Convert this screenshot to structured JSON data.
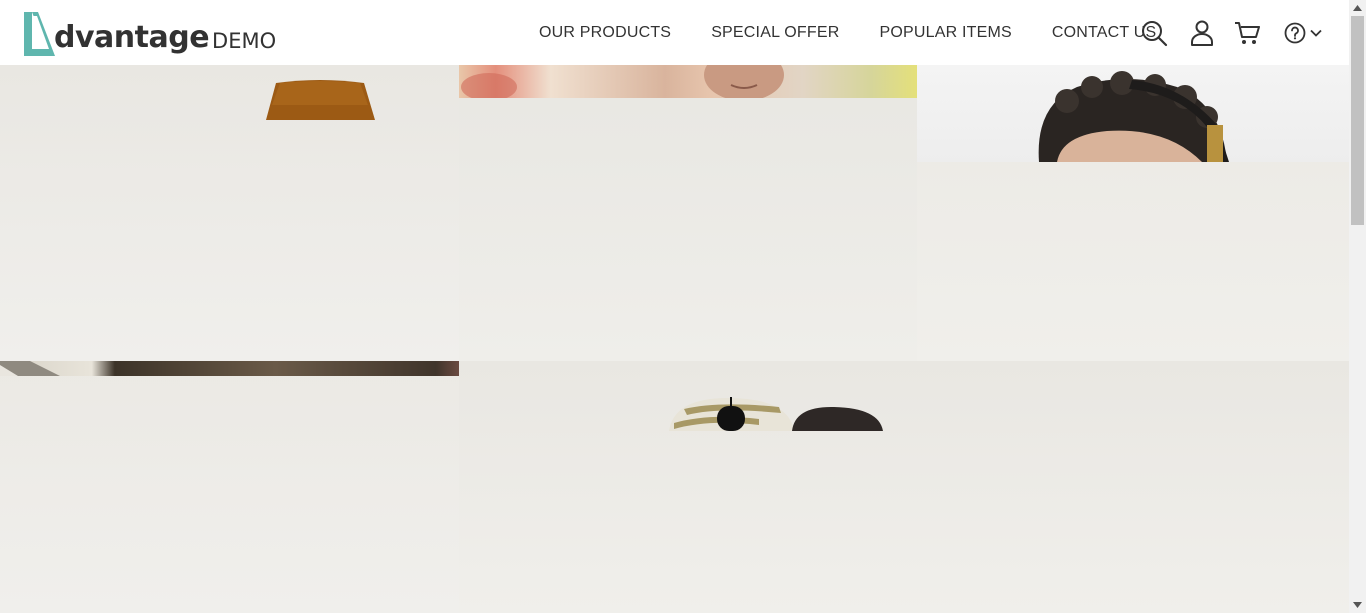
{
  "logo": {
    "word": "dvantage",
    "suffix": "DEMO"
  },
  "nav": {
    "items": [
      {
        "label": "OUR PRODUCTS"
      },
      {
        "label": "SPECIAL OFFER"
      },
      {
        "label": "POPULAR ITEMS"
      },
      {
        "label": "CONTACT US"
      }
    ]
  },
  "icons": {
    "search": "search-icon",
    "user": "user-icon",
    "cart": "cart-icon",
    "help": "help-icon",
    "help_dropdown": "chevron-down-icon"
  },
  "colors": {
    "brand_teal": "#5fb6ae",
    "text_dark": "#323232",
    "tile_bg": "#ecebe6"
  }
}
